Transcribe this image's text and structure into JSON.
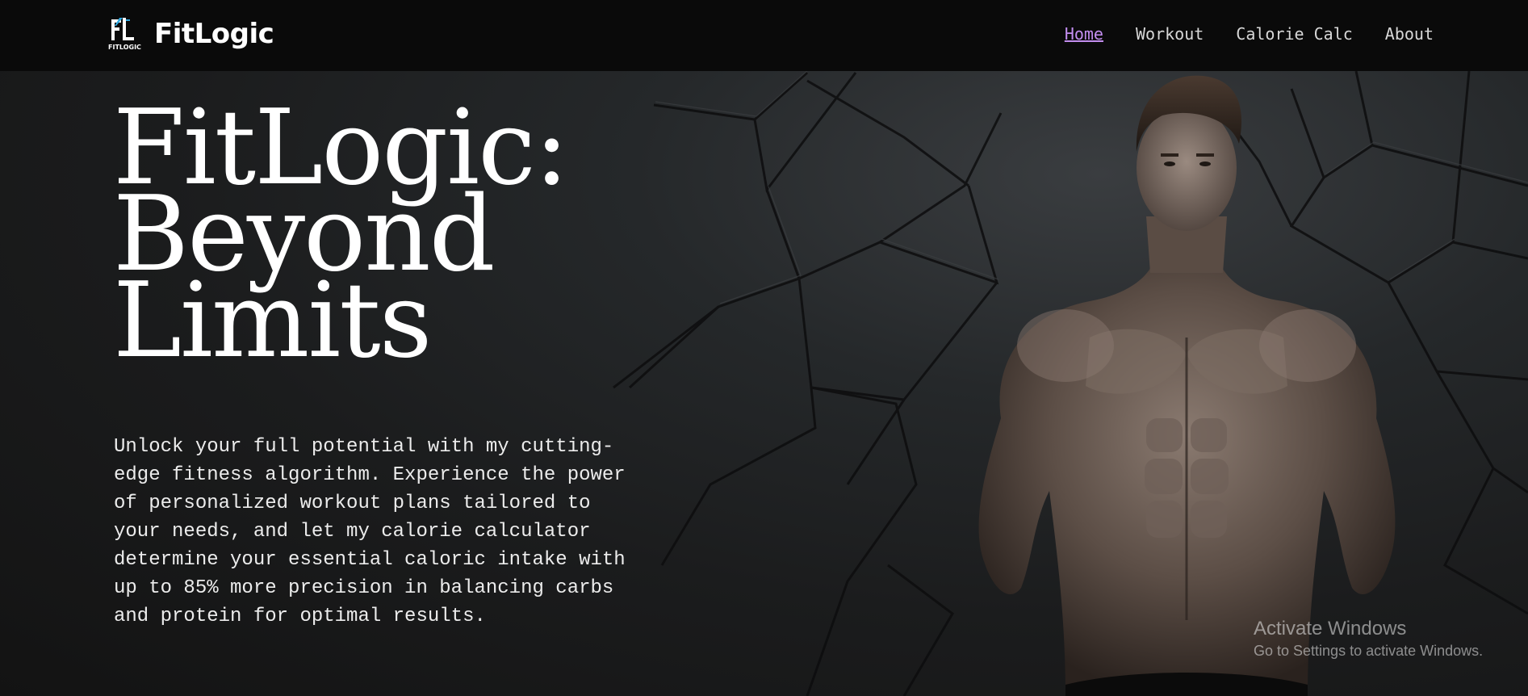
{
  "brand": {
    "logo_mark": "FL",
    "logo_caption": "FITLOGIC",
    "name": "FitLogic"
  },
  "nav": {
    "items": [
      {
        "label": "Home",
        "active": true
      },
      {
        "label": "Workout",
        "active": false
      },
      {
        "label": "Calorie Calc",
        "active": false
      },
      {
        "label": "About",
        "active": false
      }
    ]
  },
  "hero": {
    "title_line1": "FitLogic:",
    "title_line2": "Beyond",
    "title_line3": "Limits",
    "description": "Unlock your full potential with my cutting-edge fitness algorithm. Experience the power of personalized workout plans tailored to your needs, and let my calorie calculator determine your essential caloric intake with up to 85% more precision in balancing carbs and protein for optimal results."
  },
  "watermark": {
    "line1": "Activate Windows",
    "line2": "Go to Settings to activate Windows."
  },
  "colors": {
    "nav_active": "#c38ef0",
    "nav_text": "#d8d8d8",
    "navbar_bg": "#0a0a0a",
    "logo_accent": "#2ea8e0"
  }
}
